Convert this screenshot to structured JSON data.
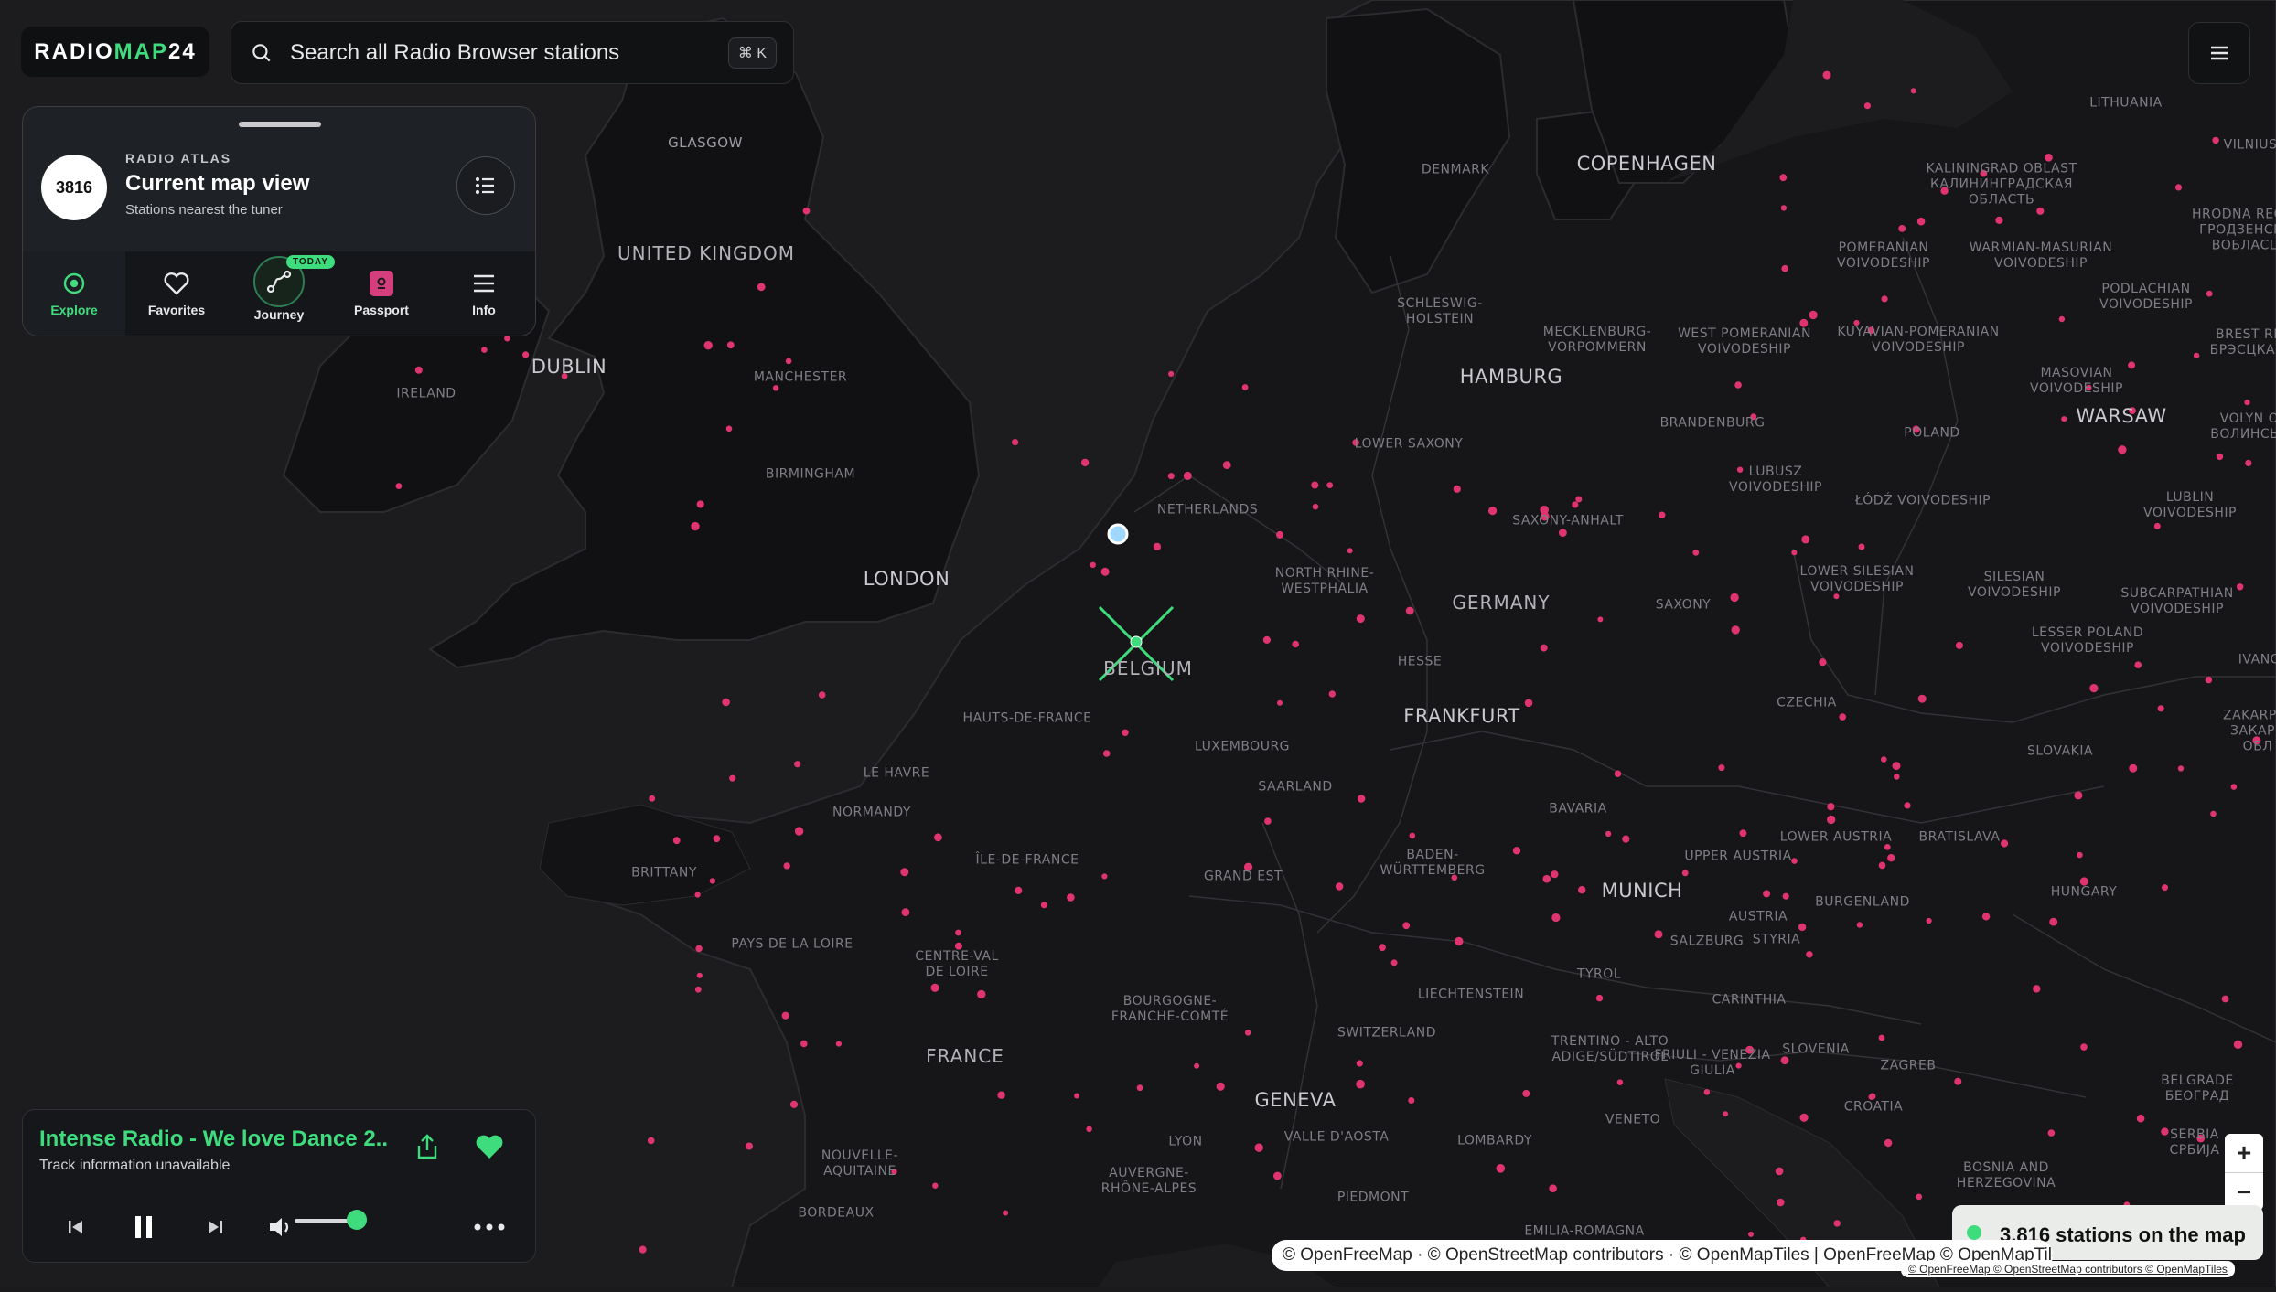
{
  "header": {
    "logo_part1": "RADIO",
    "logo_part2": "MAP",
    "logo_part3": "24",
    "search_placeholder": "Search all Radio Browser stations",
    "search_shortcut": "⌘ K"
  },
  "atlas": {
    "count": "3816",
    "eyebrow": "RADIO ATLAS",
    "title": "Current map view",
    "subtitle": "Stations nearest the tuner"
  },
  "tabs": [
    {
      "label": "Explore",
      "icon": "compass-icon",
      "active": true
    },
    {
      "label": "Favorites",
      "icon": "heart-icon"
    },
    {
      "label": "Journey",
      "icon": "route-icon",
      "badge": "TODAY"
    },
    {
      "label": "Passport",
      "icon": "passport-icon"
    },
    {
      "label": "Info",
      "icon": "menu-icon"
    }
  ],
  "player": {
    "station_title": "Intense Radio - We love Dance 2...",
    "track_info": "Track information unavailable",
    "volume": 0.75
  },
  "status": {
    "stations_on_map": "3,816 stations on the map"
  },
  "attribution": {
    "main": "© OpenFreeMap · © OpenStreetMap contributors · © OpenMapTiles | OpenFreeMap © OpenMapTiles",
    "small": "© OpenFreeMap © OpenStreetMap contributors © OpenMapTiles"
  },
  "colors": {
    "accent": "#3fdc7e",
    "station_dot": "#e0346f",
    "background": "#1a191c"
  },
  "map_labels": {
    "glasgow": "GLASGOW",
    "united_kingdom": "UNITED KINGDOM",
    "dublin": "DUBLIN",
    "ireland": "IRELAND",
    "manchester": "MANCHESTER",
    "birmingham": "BIRMINGHAM",
    "london": "LONDON",
    "denmark": "DENMARK",
    "copenhagen": "COPENHAGEN",
    "schleswig": "SCHLESWIG-\nHOLSTEIN",
    "hamburg": "HAMBURG",
    "mecklenburg": "MECKLENBURG-\nVORPOMMERN",
    "lower_saxony": "LOWER SAXONY",
    "netherlands": "NETHERLANDS",
    "saxony_anhalt": "SAXONY-ANHALT",
    "brandenburg": "BRANDENBURG",
    "north_rhine": "NORTH RHINE-\nWESTPHALIA",
    "germany": "GERMANY",
    "saxony": "SAXONY",
    "belgium": "BELGIUM",
    "hesse": "HESSE",
    "frankfurt": "FRANKFURT",
    "hauts_de_france": "HAUTS-DE-FRANCE",
    "luxembourg": "LUXEMBOURG",
    "saarland": "SAARLAND",
    "le_havre": "LE HAVRE",
    "normandy": "NORMANDY",
    "bavaria": "BAVARIA",
    "czechia": "CZECHIA",
    "brittany": "BRITTANY",
    "ile_de_france": "ÎLE-DE-FRANCE",
    "grand_est": "GRAND EST",
    "baden": "BADEN-\nWÜRTTEMBERG",
    "munich": "MUNICH",
    "austria": "AUSTRIA",
    "pays_de_la_loire": "PAYS DE LA LOIRE",
    "centre_val": "CENTRE-VAL\nDE LOIRE",
    "bourgogne": "BOURGOGNE-\nFRANCHE-COMTÉ",
    "liechtenstein": "LIECHTENSTEIN",
    "tyrol": "TYROL",
    "salzburg": "SALZBURG",
    "france": "FRANCE",
    "switzerland": "SWITZERLAND",
    "geneva": "GENEVA",
    "trentino": "TRENTINO - ALTO\nADIGE/SÜDTIROL",
    "friuli": "FRIULI - VENEZIA\nGIULIA",
    "lyon": "LYON",
    "valle_aosta": "VALLE D'AOSTA",
    "lombardy": "LOMBARDY",
    "veneto": "VENETO",
    "nouvelle_aquitaine": "NOUVELLE-\nAQUITAINE",
    "auvergne": "AUVERGNE-\nRHÔNE-ALPES",
    "piedmont": "PIEDMONT",
    "bordeaux": "BORDEAUX",
    "emilia": "EMILIA-ROMAGNA",
    "lithuania": "LITHUANIA",
    "vilnius": "VILNIUS",
    "kaliningrad": "KALININGRAD OBLAST\nКАЛИНИНГРАДСКАЯ\nОБЛАСТЬ",
    "pomeranian": "POMERANIAN\nVOIVODESHIP",
    "warmian": "WARMIAN-MASURIAN\nVOIVODESHIP",
    "podlachian": "PODLACHIAN\nVOIVODESHIP",
    "hrodna": "HRODNA REGION\nГРОДЗЕНСКАЯ\nВОБЛАСЦЬ",
    "brest": "BREST REG\nБРЭСЦКАЯ В",
    "west_pomeranian": "WEST POMERANIAN\nVOIVODESHIP",
    "kuyavian": "KUYAVIAN-POMERANIAN\nVOIVODESHIP",
    "masovian": "MASOVIAN\nVOIVODESHIP",
    "warsaw": "WARSAW",
    "poland": "POLAND",
    "volyn": "VOLYN OB\nВОЛИНСЬКА",
    "lubusz": "LUBUSZ\nVOIVODESHIP",
    "lodz": "ŁÓDŹ VOIVODESHIP",
    "lublin": "LUBLIN\nVOIVODESHIP",
    "lower_silesian": "LOWER SILESIAN\nVOIVODESHIP",
    "silesian": "SILESIAN\nVOIVODESHIP",
    "subcarpathian": "SUBCARPATHIAN\nVOIVODESHIP",
    "lesser_poland": "LESSER POLAND\nVOIVODESHIP",
    "ivano": "IVANO",
    "zakarpat": "ZAKARPAT\nЗАКАРП\nОБЛ",
    "slovakia": "SLOVAKIA",
    "lower_austria": "LOWER AUSTRIA",
    "bratislava": "BRATISLAVA",
    "upper_austria": "UPPER AUSTRIA",
    "burgenland": "BURGENLAND",
    "hungary": "HUNGARY",
    "styria": "STYRIA",
    "carinthia": "CARINTHIA",
    "slovenia": "SLOVENIA",
    "zagreb": "ZAGREB",
    "croatia": "CROATIA",
    "belgrade": "BELGRADE\nБЕОГРАД",
    "serbia": "SERBIA\nСРБИЈА",
    "bosnia": "BOSNIA AND\nHERZEGOVINA"
  }
}
